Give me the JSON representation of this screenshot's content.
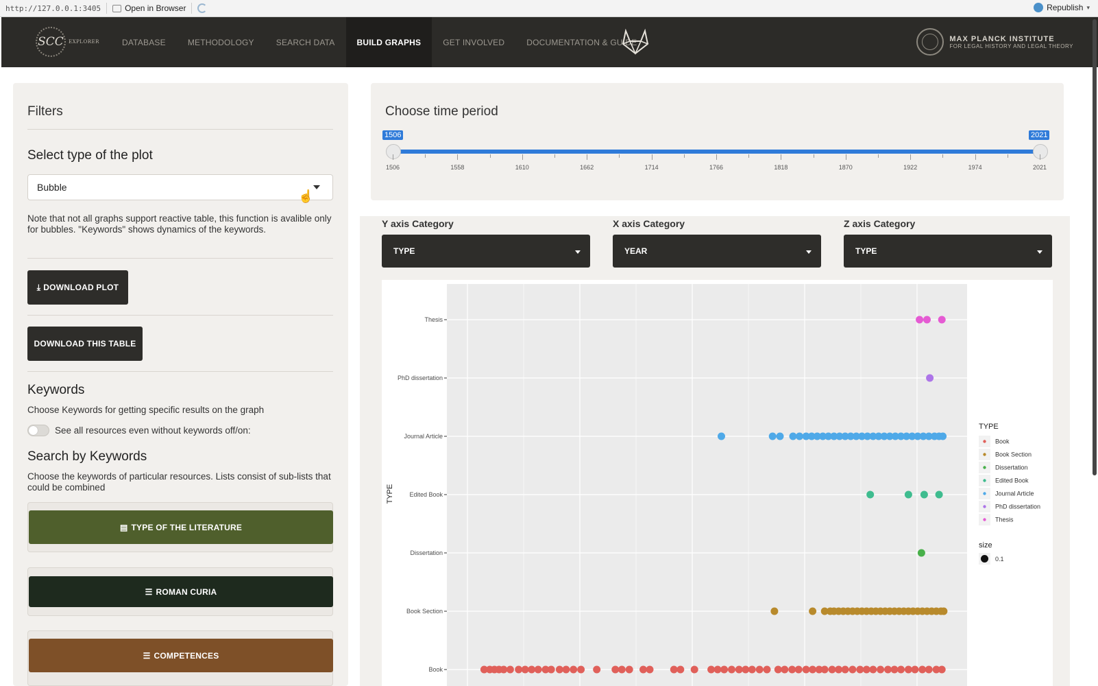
{
  "viewer": {
    "url": "http://127.0.0.1:3405",
    "open_in_browser": "Open in Browser",
    "republish": "Republish"
  },
  "navbar": {
    "brand": "SCC",
    "brand_sub": "EXPLORER",
    "items": [
      {
        "label": "DATABASE",
        "active": false
      },
      {
        "label": "METHODOLOGY",
        "active": false
      },
      {
        "label": "SEARCH DATA",
        "active": false
      },
      {
        "label": "BUILD GRAPHS",
        "active": true
      },
      {
        "label": "GET INVOLVED",
        "active": false
      },
      {
        "label": "DOCUMENTATION & GUIDE",
        "active": false
      }
    ],
    "institute_line1": "MAX PLANCK INSTITUTE",
    "institute_line2": "FOR LEGAL HISTORY AND LEGAL THEORY"
  },
  "filters": {
    "title": "Filters",
    "plot_type_label": "Select type of the plot",
    "plot_type_value": "Bubble",
    "note": "Note that not all graphs support reactive table, this function is avalible only for bubbles. \"Keywords\" shows dynamics of the keywords.",
    "download_plot": "DOWNLOAD PLOT",
    "download_table": "DOWNLOAD THIS TABLE",
    "keywords_title": "Keywords",
    "keywords_desc": "Choose Keywords for getting specific results on the graph",
    "toggle_label": "See all resources even without keywords off/on:",
    "toggle_on": false,
    "search_title": "Search by Keywords",
    "search_desc": "Choose the keywords of particular resources. Lists consist of sub-lists that could be combined",
    "keyword_groups": [
      {
        "label": "TYPE OF THE LITERATURE",
        "color": "#4f5f2c",
        "icon": "book-icon"
      },
      {
        "label": "ROMAN CURIA",
        "color": "#1e2a1e",
        "icon": "list-icon"
      },
      {
        "label": "COMPETENCES",
        "color": "#7e5028",
        "icon": "list-icon"
      }
    ]
  },
  "time_period": {
    "title": "Choose time period",
    "min": 1506,
    "max": 2021,
    "selected_from": "1506",
    "selected_to": "2021",
    "tick_labels": [
      "1506",
      "1558",
      "1610",
      "1662",
      "1714",
      "1766",
      "1818",
      "1870",
      "1922",
      "1974",
      "2021"
    ]
  },
  "axes": {
    "y_label": "Y axis Category",
    "y_value": "TYPE",
    "x_label": "X axis Category",
    "x_value": "YEAR",
    "z_label": "Z axis Category",
    "z_value": "TYPE"
  },
  "chart_data": {
    "type": "scatter",
    "ylabel": "TYPE",
    "categories": [
      "Book",
      "Book Section",
      "Dissertation",
      "Edited Book",
      "Journal Article",
      "PhD dissertation",
      "Thesis"
    ],
    "legend_title": "TYPE",
    "size_legend_title": "size",
    "size_legend_value": "0.1",
    "legend_position": "right",
    "grid": true,
    "xlim": [
      1506,
      2021
    ],
    "series": [
      {
        "name": "Book",
        "color": "#e0605a",
        "x": [
          1524,
          1530,
          1535,
          1540,
          1545,
          1552,
          1561,
          1568,
          1575,
          1582,
          1590,
          1596,
          1605,
          1612,
          1620,
          1628,
          1645,
          1665,
          1672,
          1680,
          1695,
          1702,
          1728,
          1735,
          1750,
          1768,
          1775,
          1782,
          1790,
          1798,
          1805,
          1812,
          1820,
          1828,
          1840,
          1847,
          1855,
          1862,
          1870,
          1877,
          1884,
          1890,
          1898,
          1905,
          1912,
          1920,
          1928,
          1935,
          1942,
          1950,
          1958,
          1965,
          1972,
          1980,
          1987,
          1995,
          2002,
          2010,
          2016
        ]
      },
      {
        "name": "Book Section",
        "color": "#b88a2c",
        "x": [
          1836,
          1877,
          1890,
          1896,
          1900,
          1905,
          1910,
          1915,
          1920,
          1925,
          1930,
          1935,
          1940,
          1945,
          1950,
          1955,
          1960,
          1965,
          1970,
          1975,
          1980,
          1985,
          1990,
          1995,
          2000,
          2005,
          2010,
          2015,
          2018
        ]
      },
      {
        "name": "Dissertation",
        "color": "#48b04a",
        "x": [
          1994
        ]
      },
      {
        "name": "Edited Book",
        "color": "#3fbc8f",
        "x": [
          1939,
          1980,
          1997,
          2013
        ]
      },
      {
        "name": "Journal Article",
        "color": "#4fa9e8",
        "x": [
          1779,
          1834,
          1842,
          1856,
          1863,
          1870,
          1876,
          1882,
          1888,
          1894,
          1900,
          1906,
          1912,
          1918,
          1924,
          1930,
          1936,
          1942,
          1948,
          1954,
          1960,
          1966,
          1972,
          1978,
          1984,
          1990,
          1996,
          2002,
          2008,
          2013,
          2017
        ]
      },
      {
        "name": "PhD dissertation",
        "color": "#ad75e8",
        "x": [
          2003
        ]
      },
      {
        "name": "Thesis",
        "color": "#e55bd3",
        "x": [
          1992,
          2000,
          2016
        ]
      }
    ]
  }
}
